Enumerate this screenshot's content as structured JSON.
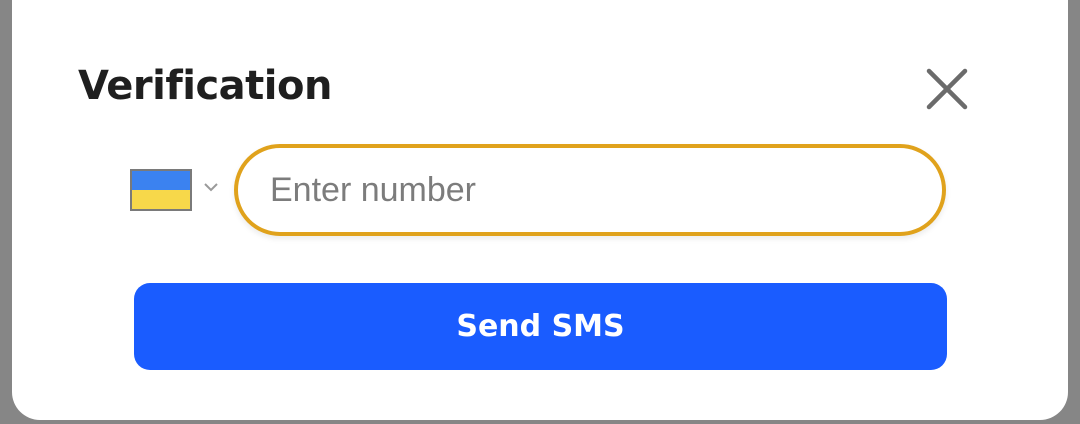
{
  "dialog": {
    "title": "Verification",
    "close_icon": "close-icon"
  },
  "phone": {
    "country": "Ukraine",
    "flag_icon": "ukraine-flag-icon",
    "flag_colors": [
      "#3b82f0",
      "#f7d84a"
    ],
    "dropdown_icon": "chevron-down-icon",
    "placeholder": "Enter number",
    "value": ""
  },
  "send_button": {
    "label": "Send SMS",
    "color": "#1a5cff"
  },
  "theme": {
    "input_border": "#e0a21c",
    "backdrop": "#868686"
  }
}
